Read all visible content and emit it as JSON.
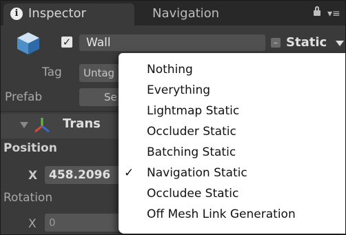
{
  "tabs": {
    "inspector_label": "Inspector",
    "navigation_label": "Navigation"
  },
  "object": {
    "active_checked": true,
    "name": "Wall",
    "static_label": "Static"
  },
  "fields": {
    "tag_label": "Tag",
    "tag_value": "Untag",
    "prefab_label": "Prefab",
    "prefab_select": "Se"
  },
  "transform": {
    "header_label": "Trans",
    "position_label": "Position",
    "x_label": "X",
    "position_x": "458.2096",
    "rotation_label": "Rotation",
    "rot_x_label": "X",
    "rotation_x": "0"
  },
  "static_menu": {
    "items": [
      {
        "label": "Nothing",
        "checked": false
      },
      {
        "label": "Everything",
        "checked": false
      },
      {
        "label": "Lightmap Static",
        "checked": false
      },
      {
        "label": "Occluder Static",
        "checked": false
      },
      {
        "label": "Batching Static",
        "checked": false
      },
      {
        "label": "Navigation Static",
        "checked": true
      },
      {
        "label": "Occludee Static",
        "checked": false
      },
      {
        "label": "Off Mesh Link Generation",
        "checked": false
      }
    ],
    "check_glyph": "✓"
  },
  "colors": {
    "panel_bg": "#3a3a3a",
    "tabbar_bg": "#282828",
    "menu_bg": "#ffffff",
    "menu_text": "#111111"
  }
}
